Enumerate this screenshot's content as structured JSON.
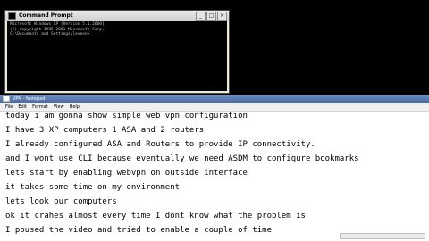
{
  "cmd": {
    "title": "Command Prompt",
    "controls": {
      "minimize": "_",
      "maximize": "□",
      "close": "×"
    },
    "lines": [
      "Microsoft Windows XP [Version 5.1.2600]",
      "(C) Copyright 1985-2001 Microsoft Corp.",
      "",
      "C:\\Documents and Settings\\leveon>"
    ]
  },
  "notepad": {
    "title": "VPN - Notepad",
    "menu": [
      "File",
      "Edit",
      "Format",
      "View",
      "Help"
    ],
    "lines": [
      "today i am gonna show simple web vpn configuration",
      "I have 3 XP computers 1 ASA and 2 routers",
      "I already configured ASA and Routers to provide IP connectivity.",
      "and I wont use CLI because eventually we need ASDM to configure bookmarks",
      "lets start by enabling webvpn on outside interface",
      "it takes some time on my environment",
      "lets look our computers",
      "ok it crahes almost every time I dont know what the problem is",
      "I poused the video and tried to enable a couple of time"
    ]
  }
}
